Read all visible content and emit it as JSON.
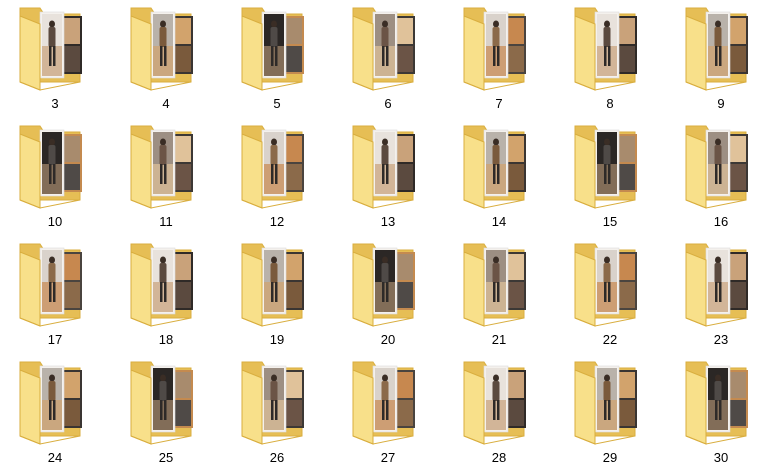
{
  "window": {
    "view": "Large icons"
  },
  "folder_icon": "folder-with-photo-thumbnails-icon",
  "colors": {
    "folder_back": "#E6BE55",
    "folder_front": "#F8E08A",
    "folder_edge": "#D9AE3F",
    "background": "#FFFFFF"
  },
  "folders": [
    {
      "label": "3"
    },
    {
      "label": "4"
    },
    {
      "label": "5"
    },
    {
      "label": "6"
    },
    {
      "label": "7"
    },
    {
      "label": "8"
    },
    {
      "label": "9"
    },
    {
      "label": "10"
    },
    {
      "label": "11"
    },
    {
      "label": "12"
    },
    {
      "label": "13"
    },
    {
      "label": "14"
    },
    {
      "label": "15"
    },
    {
      "label": "16"
    },
    {
      "label": "17"
    },
    {
      "label": "18"
    },
    {
      "label": "19"
    },
    {
      "label": "20"
    },
    {
      "label": "21"
    },
    {
      "label": "22"
    },
    {
      "label": "23"
    },
    {
      "label": "24"
    },
    {
      "label": "25"
    },
    {
      "label": "26"
    },
    {
      "label": "27"
    },
    {
      "label": "28"
    },
    {
      "label": "29"
    },
    {
      "label": "30"
    }
  ]
}
